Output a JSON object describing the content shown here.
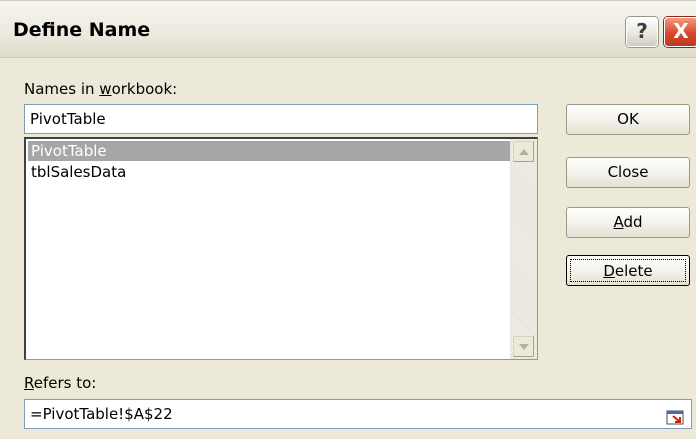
{
  "window": {
    "title": "Define Name",
    "help_label": "?",
    "close_label": "X"
  },
  "names": {
    "label_pre": "Names in ",
    "label_accel": "w",
    "label_post": "orkbook:",
    "input_value": "PivotTable",
    "items": [
      {
        "label": "PivotTable",
        "selected": true
      },
      {
        "label": "tblSalesData",
        "selected": false
      }
    ]
  },
  "refers": {
    "label_accel": "R",
    "label_post": "efers to:",
    "value": "=PivotTable!$A$22"
  },
  "buttons": {
    "ok": "OK",
    "close": "Close",
    "add_accel": "A",
    "add_post": "dd",
    "delete_accel": "D",
    "delete_post": "elete"
  }
}
